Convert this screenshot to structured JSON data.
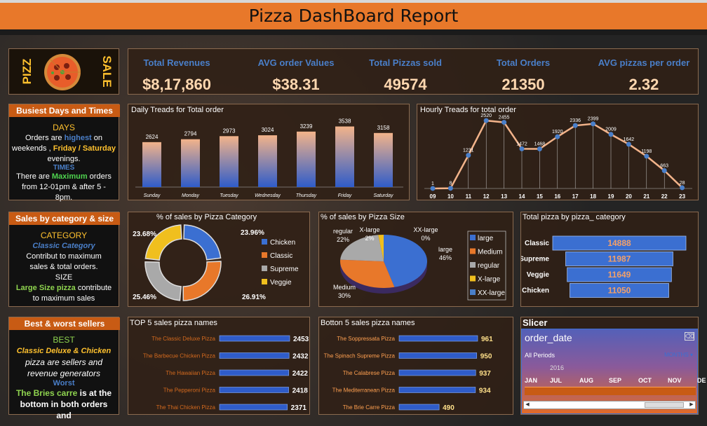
{
  "header": {
    "title": "Pizza DashBoard Report"
  },
  "brand": {
    "left": "PIZZ",
    "right": "SALE"
  },
  "kpis": [
    {
      "label": "Total Revenues",
      "value": "$8,17,860"
    },
    {
      "label": "AVG order Values",
      "value": "$38.31"
    },
    {
      "label": "Total Pizzas sold",
      "value": "49574"
    },
    {
      "label": "Total Orders",
      "value": "21350"
    },
    {
      "label": "AVG pizzas per order",
      "value": "2.32"
    }
  ],
  "busiest": {
    "title": "Busiest Days and Times",
    "days_head": "DAYS",
    "days_line1a": "Orders are ",
    "days_line1b": "highest",
    "days_line1c": " on",
    "days_line2a": "weekends , ",
    "days_line2b": "Friday / Saturday",
    "days_line3": "evenings.",
    "times_head": "TIMES",
    "times_line1a": "There are ",
    "times_line1b": "Maximum",
    "times_line1c": " orders",
    "times_line2": "from 12-01pm &   after 5 -",
    "times_line3": "8pm."
  },
  "category_size": {
    "title": "Sales by category & size",
    "cat_head": "CATEGORY",
    "cat_line1": "Classic Category",
    "cat_line2": "Contribut to maximum",
    "cat_line3": "sales & total orders.",
    "size_head": "SIZE",
    "size_line1a": "Large Size pizza",
    "size_line1b": " contribute",
    "size_line2": "to maximum sales"
  },
  "best_worst": {
    "title": "Best & worst sellers",
    "best_head": "BEST",
    "best_line1": "Classic Deluxe & Chicken",
    "best_line2": "pizza are sellers and",
    "best_line3": "revenue generators",
    "worst_head": "Worst",
    "worst_line1a": "The Bries carre",
    "worst_line1b": " is at the",
    "worst_line2": "bottom in both orders and"
  },
  "charts_titles": {
    "daily": "Daily Treads for Total order",
    "hourly": "Hourly Treads for total order",
    "category_pct": "% of sales by Pizza Category",
    "size_pct": "% of sales by  Pizza Size",
    "total_by_cat": "Total pizza by pizza_ category",
    "top5": "TOP 5 sales pizza names",
    "bottom5": "Botton 5 sales pizza names"
  },
  "chart_data": [
    {
      "type": "bar",
      "title": "Daily Treads for Total order",
      "categories": [
        "Sunday",
        "Monday",
        "Tuesday",
        "Wednesday",
        "Thursday",
        "Friday",
        "Saturday"
      ],
      "values": [
        2624,
        2794,
        2973,
        3024,
        3239,
        3538,
        3158
      ]
    },
    {
      "type": "line",
      "title": "Hourly Treads for total order",
      "x": [
        "09",
        "10",
        "11",
        "12",
        "13",
        "14",
        "15",
        "16",
        "17",
        "18",
        "19",
        "20",
        "21",
        "22",
        "23"
      ],
      "values": [
        1,
        8,
        1231,
        2520,
        2455,
        1472,
        1468,
        1920,
        2336,
        2399,
        2009,
        1642,
        1198,
        663,
        28
      ]
    },
    {
      "type": "pie",
      "title": "% of sales by Pizza Category",
      "labels": [
        "Chicken",
        "Classic",
        "Supreme",
        "Veggie"
      ],
      "values": [
        23.96,
        26.91,
        25.46,
        23.68
      ],
      "value_labels": [
        "23.96%",
        "26.91%",
        "25.46%",
        "23.68%"
      ],
      "colors": [
        "#3b6fd1",
        "#e8782a",
        "#a9a9a9",
        "#f0bf1e"
      ]
    },
    {
      "type": "pie",
      "title": "% of sales by  Pizza Size",
      "labels": [
        "large",
        "Medium",
        "regular",
        "X-large",
        "XX-large"
      ],
      "values": [
        46,
        30,
        22,
        2,
        0
      ],
      "value_labels": [
        "46%",
        "30%",
        "22%",
        "2%",
        "0%"
      ],
      "colors": [
        "#3b6fd1",
        "#e8782a",
        "#a9a9a9",
        "#f0bf1e",
        "#4a7fc9"
      ]
    },
    {
      "type": "bar",
      "title": "Total pizza by pizza_ category",
      "categories": [
        "Classic",
        "Supreme",
        "Veggie",
        "Chicken"
      ],
      "values": [
        14888,
        11987,
        11649,
        11050
      ]
    },
    {
      "type": "bar",
      "title": "TOP 5 sales pizza names",
      "categories": [
        "The Classic Deluxe Pizza",
        "The Barbecue Chicken Pizza",
        "The Hawaiian Pizza",
        "The Pepperoni Pizza",
        "The Thai Chicken Pizza"
      ],
      "values": [
        2453,
        2432,
        2422,
        2418,
        2371
      ]
    },
    {
      "type": "bar",
      "title": "Botton 5 sales pizza names",
      "categories": [
        "The Soppressata Pizza",
        "The Spinach Supreme Pizza",
        "The Calabrese Pizza",
        "The Mediterranean Pizza",
        "The Brie Carre Pizza"
      ],
      "values": [
        961,
        950,
        937,
        934,
        490
      ]
    }
  ],
  "slicer": {
    "panel_title": "Slicer",
    "field": "order_date",
    "period": "All Periods",
    "unit": "MONTHS",
    "year": "2016",
    "months": [
      "JAN",
      "JUL",
      "AUG",
      "SEP",
      "OCT",
      "NOV",
      "DE"
    ]
  }
}
